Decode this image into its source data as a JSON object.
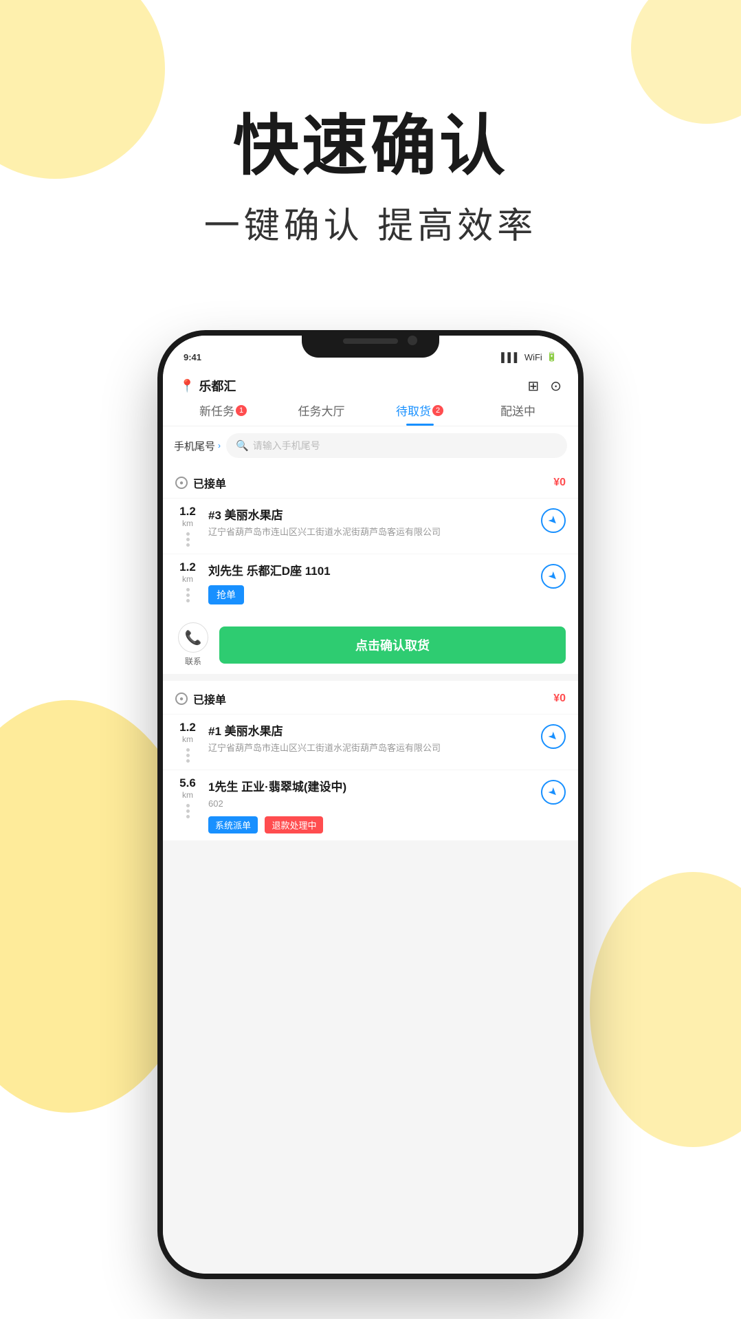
{
  "hero": {
    "title": "快速确认",
    "subtitle": "一键确认 提高效率"
  },
  "phone": {
    "location": "乐都汇",
    "tabs": [
      {
        "label": "新任务",
        "badge": "1",
        "active": false
      },
      {
        "label": "任务大厅",
        "badge": null,
        "active": false
      },
      {
        "label": "待取货",
        "badge": "2",
        "active": true
      },
      {
        "label": "配送中",
        "badge": null,
        "active": false
      }
    ],
    "search": {
      "filter_label": "手机尾号",
      "placeholder": "请输入手机尾号"
    },
    "sections": [
      {
        "id": "section1",
        "title": "已接单",
        "amount": "¥0",
        "orders": [
          {
            "distance": "1.2",
            "unit": "km",
            "title": "#3 美丽水果店",
            "address": "辽宁省葫芦岛市连山区兴工街道水泥街葫芦岛客运有限公司"
          },
          {
            "distance": "1.2",
            "unit": "km",
            "title": "刘先生 乐都汇D座 1101",
            "address": "",
            "grab_label": "抢单",
            "has_action": true,
            "contact_label": "联系",
            "confirm_label": "点击确认取货"
          }
        ]
      },
      {
        "id": "section2",
        "title": "已接单",
        "amount": "¥0",
        "orders": [
          {
            "distance": "1.2",
            "unit": "km",
            "title": "#1 美丽水果店",
            "address": "辽宁省葫芦岛市连山区兴工街道水泥街葫芦岛客运有限公司"
          },
          {
            "distance": "5.6",
            "unit": "km",
            "title": "1先生 正业·翡翠城(建设中)",
            "address": "602",
            "tags": [
              "系统派单",
              "退款处理中"
            ]
          }
        ]
      }
    ]
  }
}
